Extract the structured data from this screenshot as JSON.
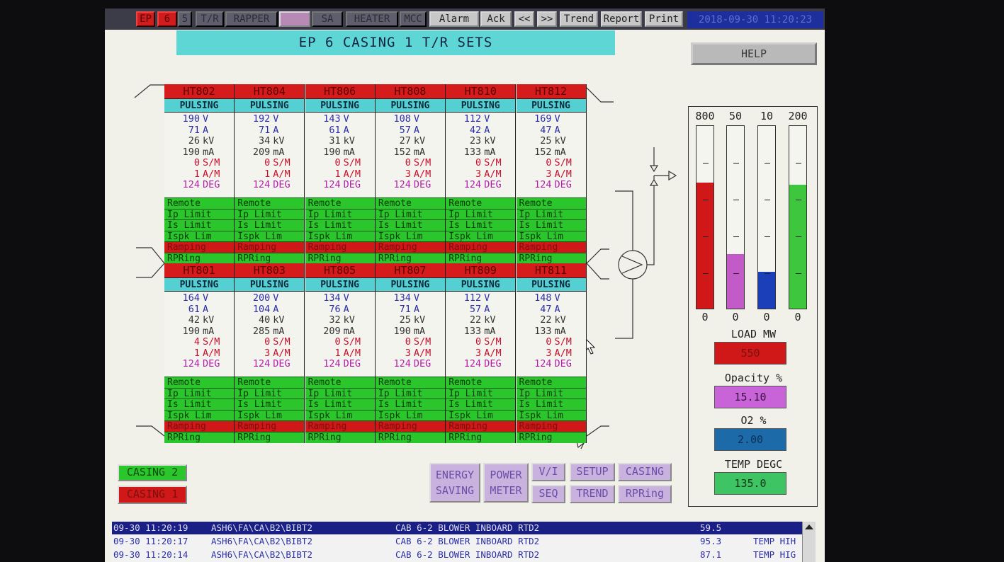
{
  "toolbar": {
    "items": [
      "EP",
      "6",
      "5",
      "T/R",
      "RAPPER",
      "",
      "SA",
      "HEATER",
      "MCC",
      "Alarm",
      "Ack",
      "<<",
      ">>",
      "Trend",
      "Report",
      "Print"
    ],
    "datetime": "2018-09-30 11:20:23"
  },
  "title": "EP 6 CASING 1 T/R SETS",
  "help_label": "HELP",
  "top_sets": [
    {
      "id": "HT802",
      "status": "PULSING",
      "v": "190",
      "a": "71",
      "kv": "26",
      "ma": "190",
      "sm": "0",
      "am": "1",
      "deg": "124"
    },
    {
      "id": "HT804",
      "status": "PULSING",
      "v": "192",
      "a": "71",
      "kv": "34",
      "ma": "209",
      "sm": "0",
      "am": "1",
      "deg": "124"
    },
    {
      "id": "HT806",
      "status": "PULSING",
      "v": "143",
      "a": "61",
      "kv": "31",
      "ma": "190",
      "sm": "0",
      "am": "1",
      "deg": "124"
    },
    {
      "id": "HT808",
      "status": "PULSING",
      "v": "108",
      "a": "57",
      "kv": "27",
      "ma": "152",
      "sm": "0",
      "am": "3",
      "deg": "124"
    },
    {
      "id": "HT810",
      "status": "PULSING",
      "v": "112",
      "a": "42",
      "kv": "23",
      "ma": "133",
      "sm": "0",
      "am": "3",
      "deg": "124"
    },
    {
      "id": "HT812",
      "status": "PULSING",
      "v": "169",
      "a": "47",
      "kv": "25",
      "ma": "152",
      "sm": "0",
      "am": "3",
      "deg": "124"
    }
  ],
  "bottom_sets": [
    {
      "id": "HT801",
      "status": "PULSING",
      "v": "164",
      "a": "61",
      "kv": "42",
      "ma": "190",
      "sm": "4",
      "am": "1",
      "deg": "124"
    },
    {
      "id": "HT803",
      "status": "PULSING",
      "v": "200",
      "a": "104",
      "kv": "40",
      "ma": "285",
      "sm": "0",
      "am": "3",
      "deg": "124"
    },
    {
      "id": "HT805",
      "status": "PULSING",
      "v": "134",
      "a": "76",
      "kv": "32",
      "ma": "209",
      "sm": "0",
      "am": "1",
      "deg": "124"
    },
    {
      "id": "HT807",
      "status": "PULSING",
      "v": "134",
      "a": "71",
      "kv": "25",
      "ma": "190",
      "sm": "0",
      "am": "3",
      "deg": "124"
    },
    {
      "id": "HT809",
      "status": "PULSING",
      "v": "112",
      "a": "57",
      "kv": "22",
      "ma": "133",
      "sm": "0",
      "am": "3",
      "deg": "124"
    },
    {
      "id": "HT811",
      "status": "PULSING",
      "v": "148",
      "a": "47",
      "kv": "22",
      "ma": "133",
      "sm": "0",
      "am": "3",
      "deg": "124"
    }
  ],
  "units": {
    "v": "V",
    "a": "A",
    "kv": "kV",
    "ma": "mA",
    "sm": "S/M",
    "am": "A/M",
    "deg": "DEG"
  },
  "status_labels": [
    "Remote",
    "Ip Limit",
    "Is Limit",
    "Ispk Lim",
    "Ramping",
    "RPRing"
  ],
  "casing_buttons": {
    "casing2": "CASING 2",
    "casing1": "CASING 1"
  },
  "nav_buttons": {
    "energy": [
      "ENERGY",
      "SAVING"
    ],
    "power": [
      "POWER",
      "METER"
    ],
    "vi": "V/I",
    "setup": "SETUP",
    "casing": "CASING",
    "seq": "SEQ",
    "trend": "TREND",
    "rpring": "RPRing"
  },
  "bars": [
    {
      "max": "800",
      "min": "0",
      "level": 0.69,
      "color": "#d01818"
    },
    {
      "max": "50",
      "min": "0",
      "level": 0.3,
      "color": "#c25ac8"
    },
    {
      "max": "10",
      "min": "0",
      "level": 0.2,
      "color": "#1a3fb8"
    },
    {
      "max": "200",
      "min": "0",
      "level": 0.68,
      "color": "#3ec63e"
    }
  ],
  "gauges": [
    {
      "label": "LOAD MW",
      "value": "550",
      "bg": "#d01818",
      "fg": "#7a1010"
    },
    {
      "label": "Opacity %",
      "value": "15.10",
      "bg": "#c864d8",
      "fg": "#3a1040"
    },
    {
      "label": "O2 %",
      "value": "2.00",
      "bg": "#1d6aa8",
      "fg": "#0d2f55"
    },
    {
      "label": "TEMP DEGC",
      "value": "135.0",
      "bg": "#3ec463",
      "fg": "#0f3a18"
    }
  ],
  "alarms": [
    {
      "time": "09-30 11:20:19",
      "tag": "ASH6\\FA\\CA\\B2\\BIBT2",
      "desc": "CAB 6-2 BLOWER INBOARD RTD2",
      "value": "59.5",
      "type": ""
    },
    {
      "time": "09-30 11:20:17",
      "tag": "ASH6\\FA\\CA\\B2\\BIBT2",
      "desc": "CAB 6-2 BLOWER INBOARD RTD2",
      "value": "95.3",
      "type": "TEMP HIH"
    },
    {
      "time": "09-30 11:20:14",
      "tag": "ASH6\\FA\\CA\\B2\\BIBT2",
      "desc": "CAB 6-2 BLOWER INBOARD RTD2",
      "value": "87.1",
      "type": "TEMP HIG"
    }
  ]
}
